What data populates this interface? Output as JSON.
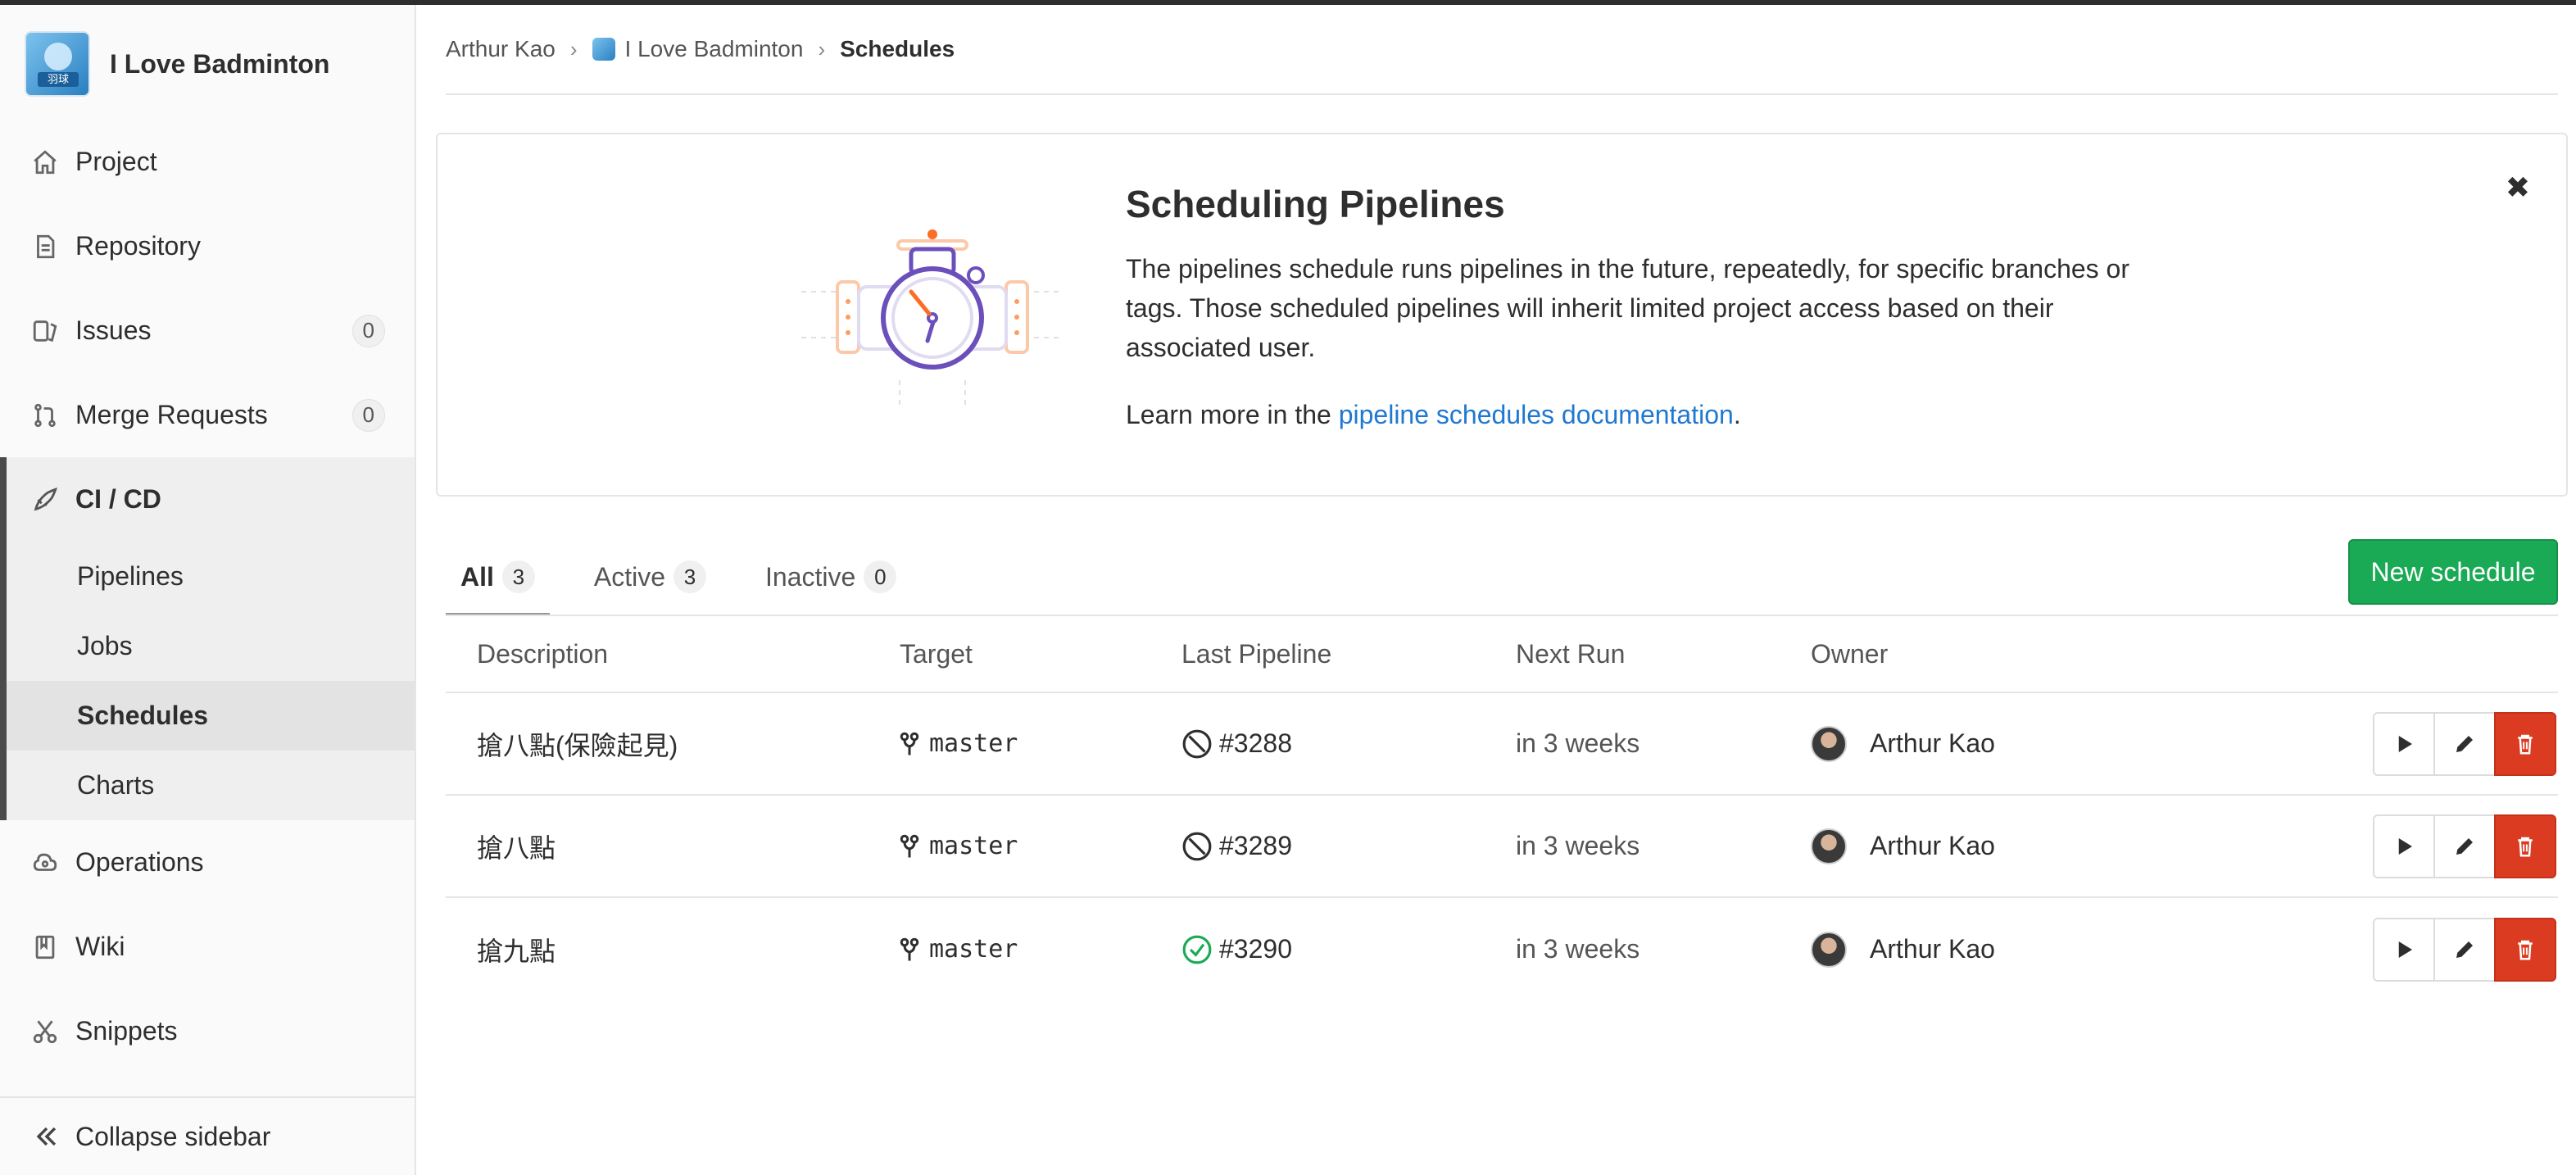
{
  "project": {
    "name": "I Love Badminton",
    "avatar_text": "羽球"
  },
  "sidebar": {
    "items": [
      {
        "label": "Project",
        "icon": "home-icon"
      },
      {
        "label": "Repository",
        "icon": "document-icon"
      },
      {
        "label": "Issues",
        "icon": "issues-icon",
        "count": "0"
      },
      {
        "label": "Merge Requests",
        "icon": "merge-request-icon",
        "count": "0"
      },
      {
        "label": "CI / CD",
        "icon": "rocket-icon"
      },
      {
        "label": "Operations",
        "icon": "cloud-gear-icon"
      },
      {
        "label": "Wiki",
        "icon": "book-icon"
      },
      {
        "label": "Snippets",
        "icon": "scissors-icon"
      }
    ],
    "cicd_sub": [
      "Pipelines",
      "Jobs",
      "Schedules",
      "Charts"
    ],
    "collapse_label": "Collapse sidebar"
  },
  "breadcrumb": {
    "user": "Arthur Kao",
    "project": "I Love Badminton",
    "current": "Schedules"
  },
  "banner": {
    "title": "Scheduling Pipelines",
    "text": "The pipelines schedule runs pipelines in the future, repeatedly, for specific branches or tags. Those scheduled pipelines will inherit limited project access based on their associated user.",
    "learn_prefix": "Learn more in the ",
    "learn_link": "pipeline schedules documentation",
    "learn_suffix": ".",
    "close_glyph": "✖"
  },
  "tabs": [
    {
      "label": "All",
      "count": "3"
    },
    {
      "label": "Active",
      "count": "3"
    },
    {
      "label": "Inactive",
      "count": "0"
    }
  ],
  "new_schedule_label": "New schedule",
  "table": {
    "headers": [
      "Description",
      "Target",
      "Last Pipeline",
      "Next Run",
      "Owner"
    ],
    "rows": [
      {
        "description": "搶八點(保險起見)",
        "target": "master",
        "pipeline": "#3288",
        "status": "canceled",
        "next_run": "in 3 weeks",
        "owner": "Arthur Kao"
      },
      {
        "description": "搶八點",
        "target": "master",
        "pipeline": "#3289",
        "status": "canceled",
        "next_run": "in 3 weeks",
        "owner": "Arthur Kao"
      },
      {
        "description": "搶九點",
        "target": "master",
        "pipeline": "#3290",
        "status": "passed",
        "next_run": "in 3 weeks",
        "owner": "Arthur Kao"
      }
    ]
  },
  "colors": {
    "success": "#1aaa55",
    "danger": "#db3b21",
    "link": "#1f78d1",
    "canceled": "#2e2e2e"
  }
}
